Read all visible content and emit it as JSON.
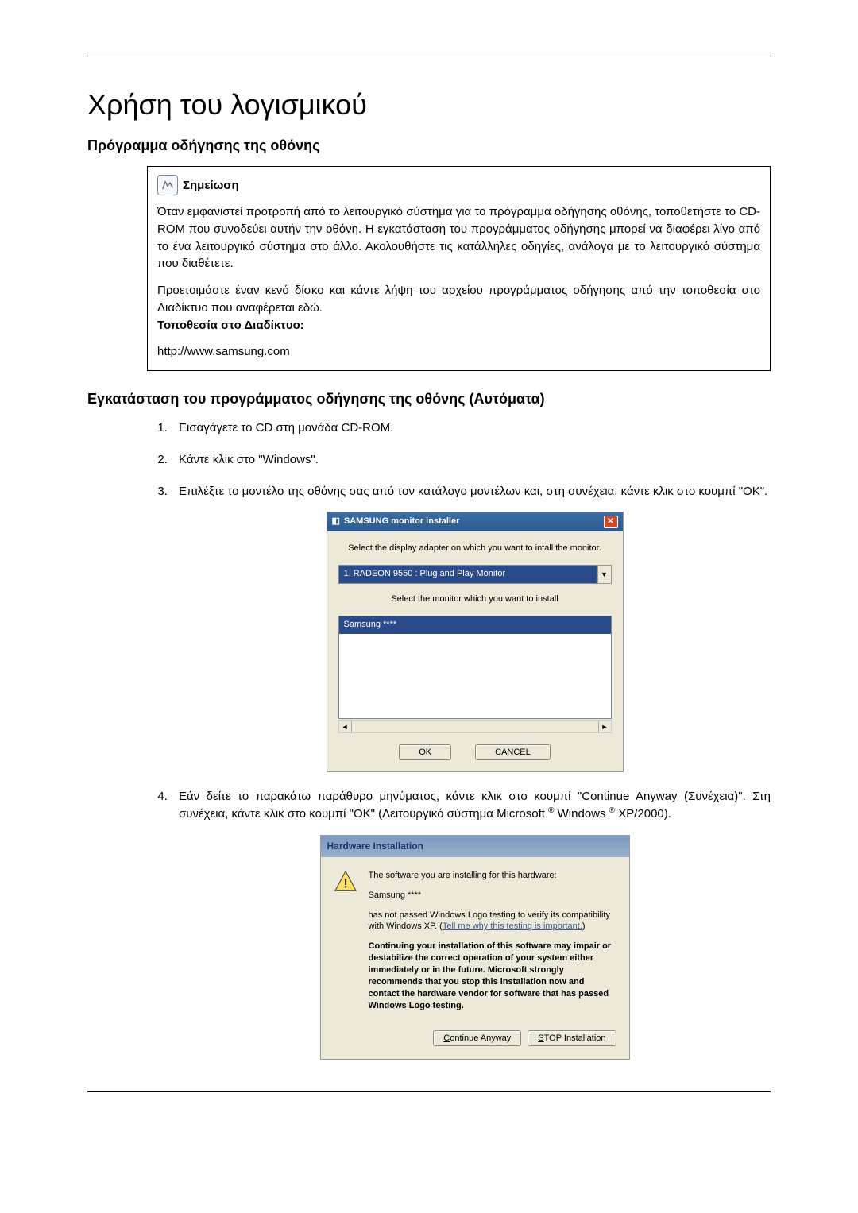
{
  "title": "Χρήση του λογισμικού",
  "section1": {
    "heading": "Πρόγραμμα οδήγησης της οθόνης",
    "note_label": "Σημείωση",
    "note_p1": "Όταν εμφανιστεί προτροπή από το λειτουργικό σύστημα για το πρόγραμμα οδήγησης οθόνης, τοποθετήστε το CD-ROM που συνοδεύει αυτήν την οθόνη. Η εγκατάσταση του προγράμματος οδήγησης μπορεί να διαφέρει λίγο από το ένα λειτουργικό σύστημα στο άλλο. Ακολουθήστε τις κατάλληλες οδηγίες, ανάλογα με το λειτουργικό σύστημα που διαθέτετε.",
    "note_p2": "Προετοιμάστε έναν κενό δίσκο και κάντε λήψη του αρχείου προγράμματος οδήγησης από την τοποθεσία στο Διαδίκτυο που αναφέρεται εδώ.",
    "note_label2": "Τοποθεσία στο Διαδίκτυο:",
    "url": "http://www.samsung.com"
  },
  "section2": {
    "heading": "Εγκατάσταση του προγράμματος οδήγησης της οθόνης (Αυτόματα)",
    "steps": [
      "Εισαγάγετε το CD στη μονάδα CD-ROM.",
      "Κάντε κλικ στο \"Windows\".",
      "Επιλέξτε το μοντέλο της οθόνης σας από τον κατάλογο μοντέλων και, στη συνέχεια, κάντε κλικ στο κουμπί \"OK\".",
      "Εάν δείτε το παρακάτω παράθυρο μηνύματος, κάντε κλικ στο κουμπί \"Continue Anyway (Συνέχεια)\". Στη συνέχεια, κάντε κλικ στο κουμπί \"OK\" (Λειτουργικό σύστημα Microsoft ® Windows ® XP/2000)."
    ]
  },
  "installer": {
    "title": "SAMSUNG monitor installer",
    "text1": "Select the display adapter on which you want to intall the monitor.",
    "dropdown": "1. RADEON 9550 : Plug and Play Monitor",
    "text2": "Select the monitor which you want to install",
    "list_item": "Samsung ****",
    "ok": "OK",
    "cancel": "CANCEL"
  },
  "hw": {
    "title": "Hardware Installation",
    "p1": "The software you are installing for this hardware:",
    "p2": "Samsung ****",
    "p3a": "has not passed Windows Logo testing to verify its compatibility with Windows XP. (",
    "p3link": "Tell me why this testing is important.",
    "p3b": ")",
    "p4": "Continuing your installation of this software may impair or destabilize the correct operation of your system either immediately or in the future. Microsoft strongly recommends that you stop this installation now and contact the hardware vendor for software that has passed Windows Logo testing.",
    "btn1": "Continue Anyway",
    "btn2": "STOP Installation"
  }
}
